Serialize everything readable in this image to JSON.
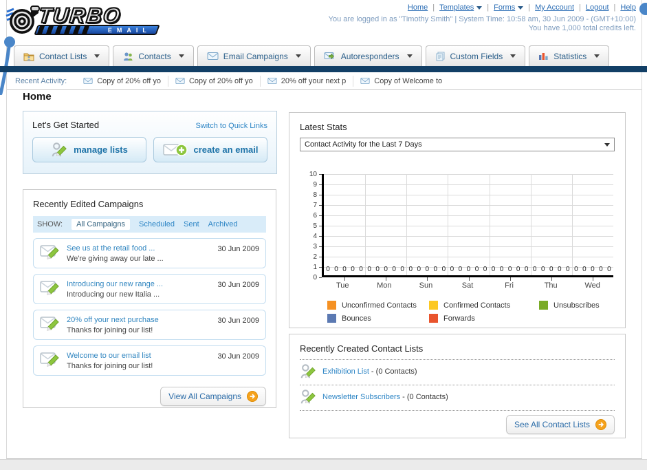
{
  "colors": {
    "navy_bar": "#123f66",
    "link_blue": "#2d85c5",
    "header_link_blue": "#2a6db5",
    "muted_login_text": "#7f9dbf",
    "panel_border": "#c9c9c9",
    "accent_orange": "#f5a21d",
    "callout_blue": "#4a86c8",
    "button_text_blue": "#1e73a8"
  },
  "logo": {
    "line1": "TURBO",
    "line2": "EMAIL"
  },
  "top_nav": {
    "items": [
      {
        "label": "Home",
        "dropdown": false
      },
      {
        "label": "Templates",
        "dropdown": true
      },
      {
        "label": "Forms",
        "dropdown": true
      },
      {
        "label": "My Account",
        "dropdown": false
      },
      {
        "label": "Logout",
        "dropdown": false
      },
      {
        "label": "Help",
        "dropdown": false
      }
    ],
    "login_line": "You are logged in as \"Timothy Smith\" | System Time: 10:58 am, 30 Jun 2009 - (GMT+10:00)",
    "credits_line": "You have 1,000 total credits left."
  },
  "main_tabs": {
    "items": [
      {
        "label": "Contact Lists",
        "icon": "folder-icon"
      },
      {
        "label": "Contacts",
        "icon": "contacts-icon"
      },
      {
        "label": "Email Campaigns",
        "icon": "envelope-icon"
      },
      {
        "label": "Autoresponders",
        "icon": "autoresponder-icon"
      },
      {
        "label": "Custom Fields",
        "icon": "pages-icon"
      },
      {
        "label": "Statistics",
        "icon": "bar-chart-icon"
      }
    ]
  },
  "recent_activity": {
    "label": "Recent Activity:",
    "items": [
      {
        "text": "Copy of 20% off yo"
      },
      {
        "text": "Copy of 20% off yo"
      },
      {
        "text": "20% off your next p"
      },
      {
        "text": "Copy of Welcome to"
      }
    ]
  },
  "page_title": "Home",
  "get_started": {
    "title": "Let's Get Started",
    "switch_link": "Switch to Quick Links",
    "manage_label": "manage lists",
    "create_label": "create an email"
  },
  "campaigns": {
    "title": "Recently Edited Campaigns",
    "show_label": "SHOW:",
    "filters": [
      {
        "label": "All Campaigns",
        "active": true
      },
      {
        "label": "Scheduled",
        "active": false
      },
      {
        "label": "Sent",
        "active": false
      },
      {
        "label": "Archived",
        "active": false
      }
    ],
    "items": [
      {
        "title": "See us at the retail food ...",
        "subtitle": "We're giving away our late ...",
        "date": "30 Jun 2009"
      },
      {
        "title": "Introducing our new range ...",
        "subtitle": "Introducing our new Italia ...",
        "date": "30 Jun 2009"
      },
      {
        "title": "20% off your next purchase",
        "subtitle": "Thanks for joining our list!",
        "date": "30 Jun 2009"
      },
      {
        "title": "Welcome to our email list",
        "subtitle": "Thanks for joining our list!",
        "date": "30 Jun 2009"
      }
    ],
    "view_all_label": "View All Campaigns"
  },
  "stats": {
    "title": "Latest Stats",
    "dropdown_value": "Contact Activity for the Last 7 Days"
  },
  "chart_data": {
    "type": "bar",
    "title": "Contact Activity for the Last 7 Days",
    "categories": [
      "Tue",
      "Mon",
      "Sun",
      "Sat",
      "Fri",
      "Thu",
      "Wed"
    ],
    "series": [
      {
        "name": "Unconfirmed Contacts",
        "color": "#f59123",
        "values": [
          0,
          0,
          0,
          0,
          0,
          0,
          0
        ]
      },
      {
        "name": "Confirmed Contacts",
        "color": "#fcc822",
        "values": [
          0,
          0,
          0,
          0,
          0,
          0,
          0
        ]
      },
      {
        "name": "Unsubscribes",
        "color": "#7aab27",
        "values": [
          0,
          0,
          0,
          0,
          0,
          0,
          0
        ]
      },
      {
        "name": "Bounces",
        "color": "#5b79b2",
        "values": [
          0,
          0,
          0,
          0,
          0,
          0,
          0
        ]
      },
      {
        "name": "Forwards",
        "color": "#e9542d",
        "values": [
          0,
          0,
          0,
          0,
          0,
          0,
          0
        ]
      }
    ],
    "xlabel": "",
    "ylabel": "",
    "ylim": [
      0,
      10
    ],
    "ytick_step": 1,
    "grid": true,
    "legend_position": "bottom",
    "value_labels_shown": true
  },
  "contact_lists": {
    "title": "Recently Created Contact Lists",
    "items": [
      {
        "name": "Exhibition List",
        "count_suffix": " - (0 Contacts)"
      },
      {
        "name": "Newsletter Subscribers",
        "count_suffix": " - (0 Contacts)"
      }
    ],
    "see_all_label": "See All Contact Lists"
  }
}
